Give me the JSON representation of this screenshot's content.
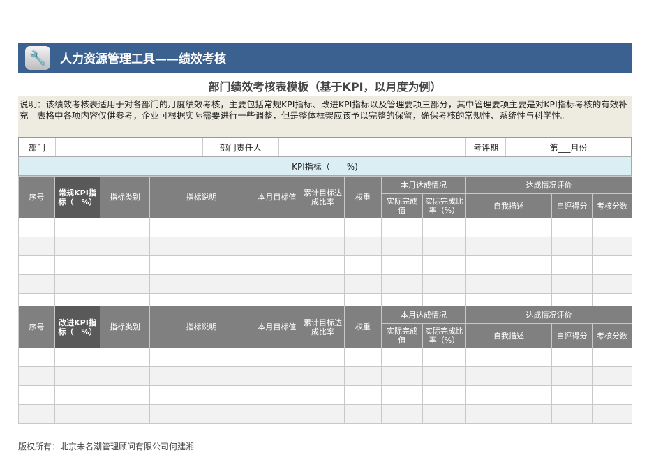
{
  "banner": {
    "title": "人力资源管理工具——绩效考核",
    "icon": "wrench-icon"
  },
  "subtitle": "部门绩效考核表模板（基于KPI，以月度为例）",
  "note": "说明：该绩效考核表适用于对各部门的月度绩效考核，主要包括常规KPI指标、改进KPI指标以及管理要项三部分，其中管理要项主要是对KPI指标考核的有效补充。表格中各项内容仅供参考，企业可根据实际需要进行一些调整，但是整体框架应该予以完整的保留，确保考核的常规性、系统性与科学性。",
  "dept_row": {
    "dept_label": "部门",
    "owner_label": "部门责任人",
    "period_label": "考评期",
    "period_value": "第___月份"
  },
  "kpi_band": "KPI指标（　　%)",
  "headers": {
    "seq": "序号",
    "kpi": "常规KPI指标（　%）",
    "improve_kpi": "改进KPI指标（　%）",
    "category": "指标类别",
    "desc": "指标说明",
    "target": "本月目标值",
    "cumulative": "累计目标达成比率",
    "weight": "权重",
    "month_status": "本月达成情况",
    "actual": "实际完成值",
    "actual_rate": "实际完成比率（%）",
    "evaluation": "达成情况评价",
    "self_desc": "自我描述",
    "self_score": "自评得分",
    "score": "考核分数"
  },
  "footer": "版权所有：北京未名潮管理顾问有限公司何建湘"
}
